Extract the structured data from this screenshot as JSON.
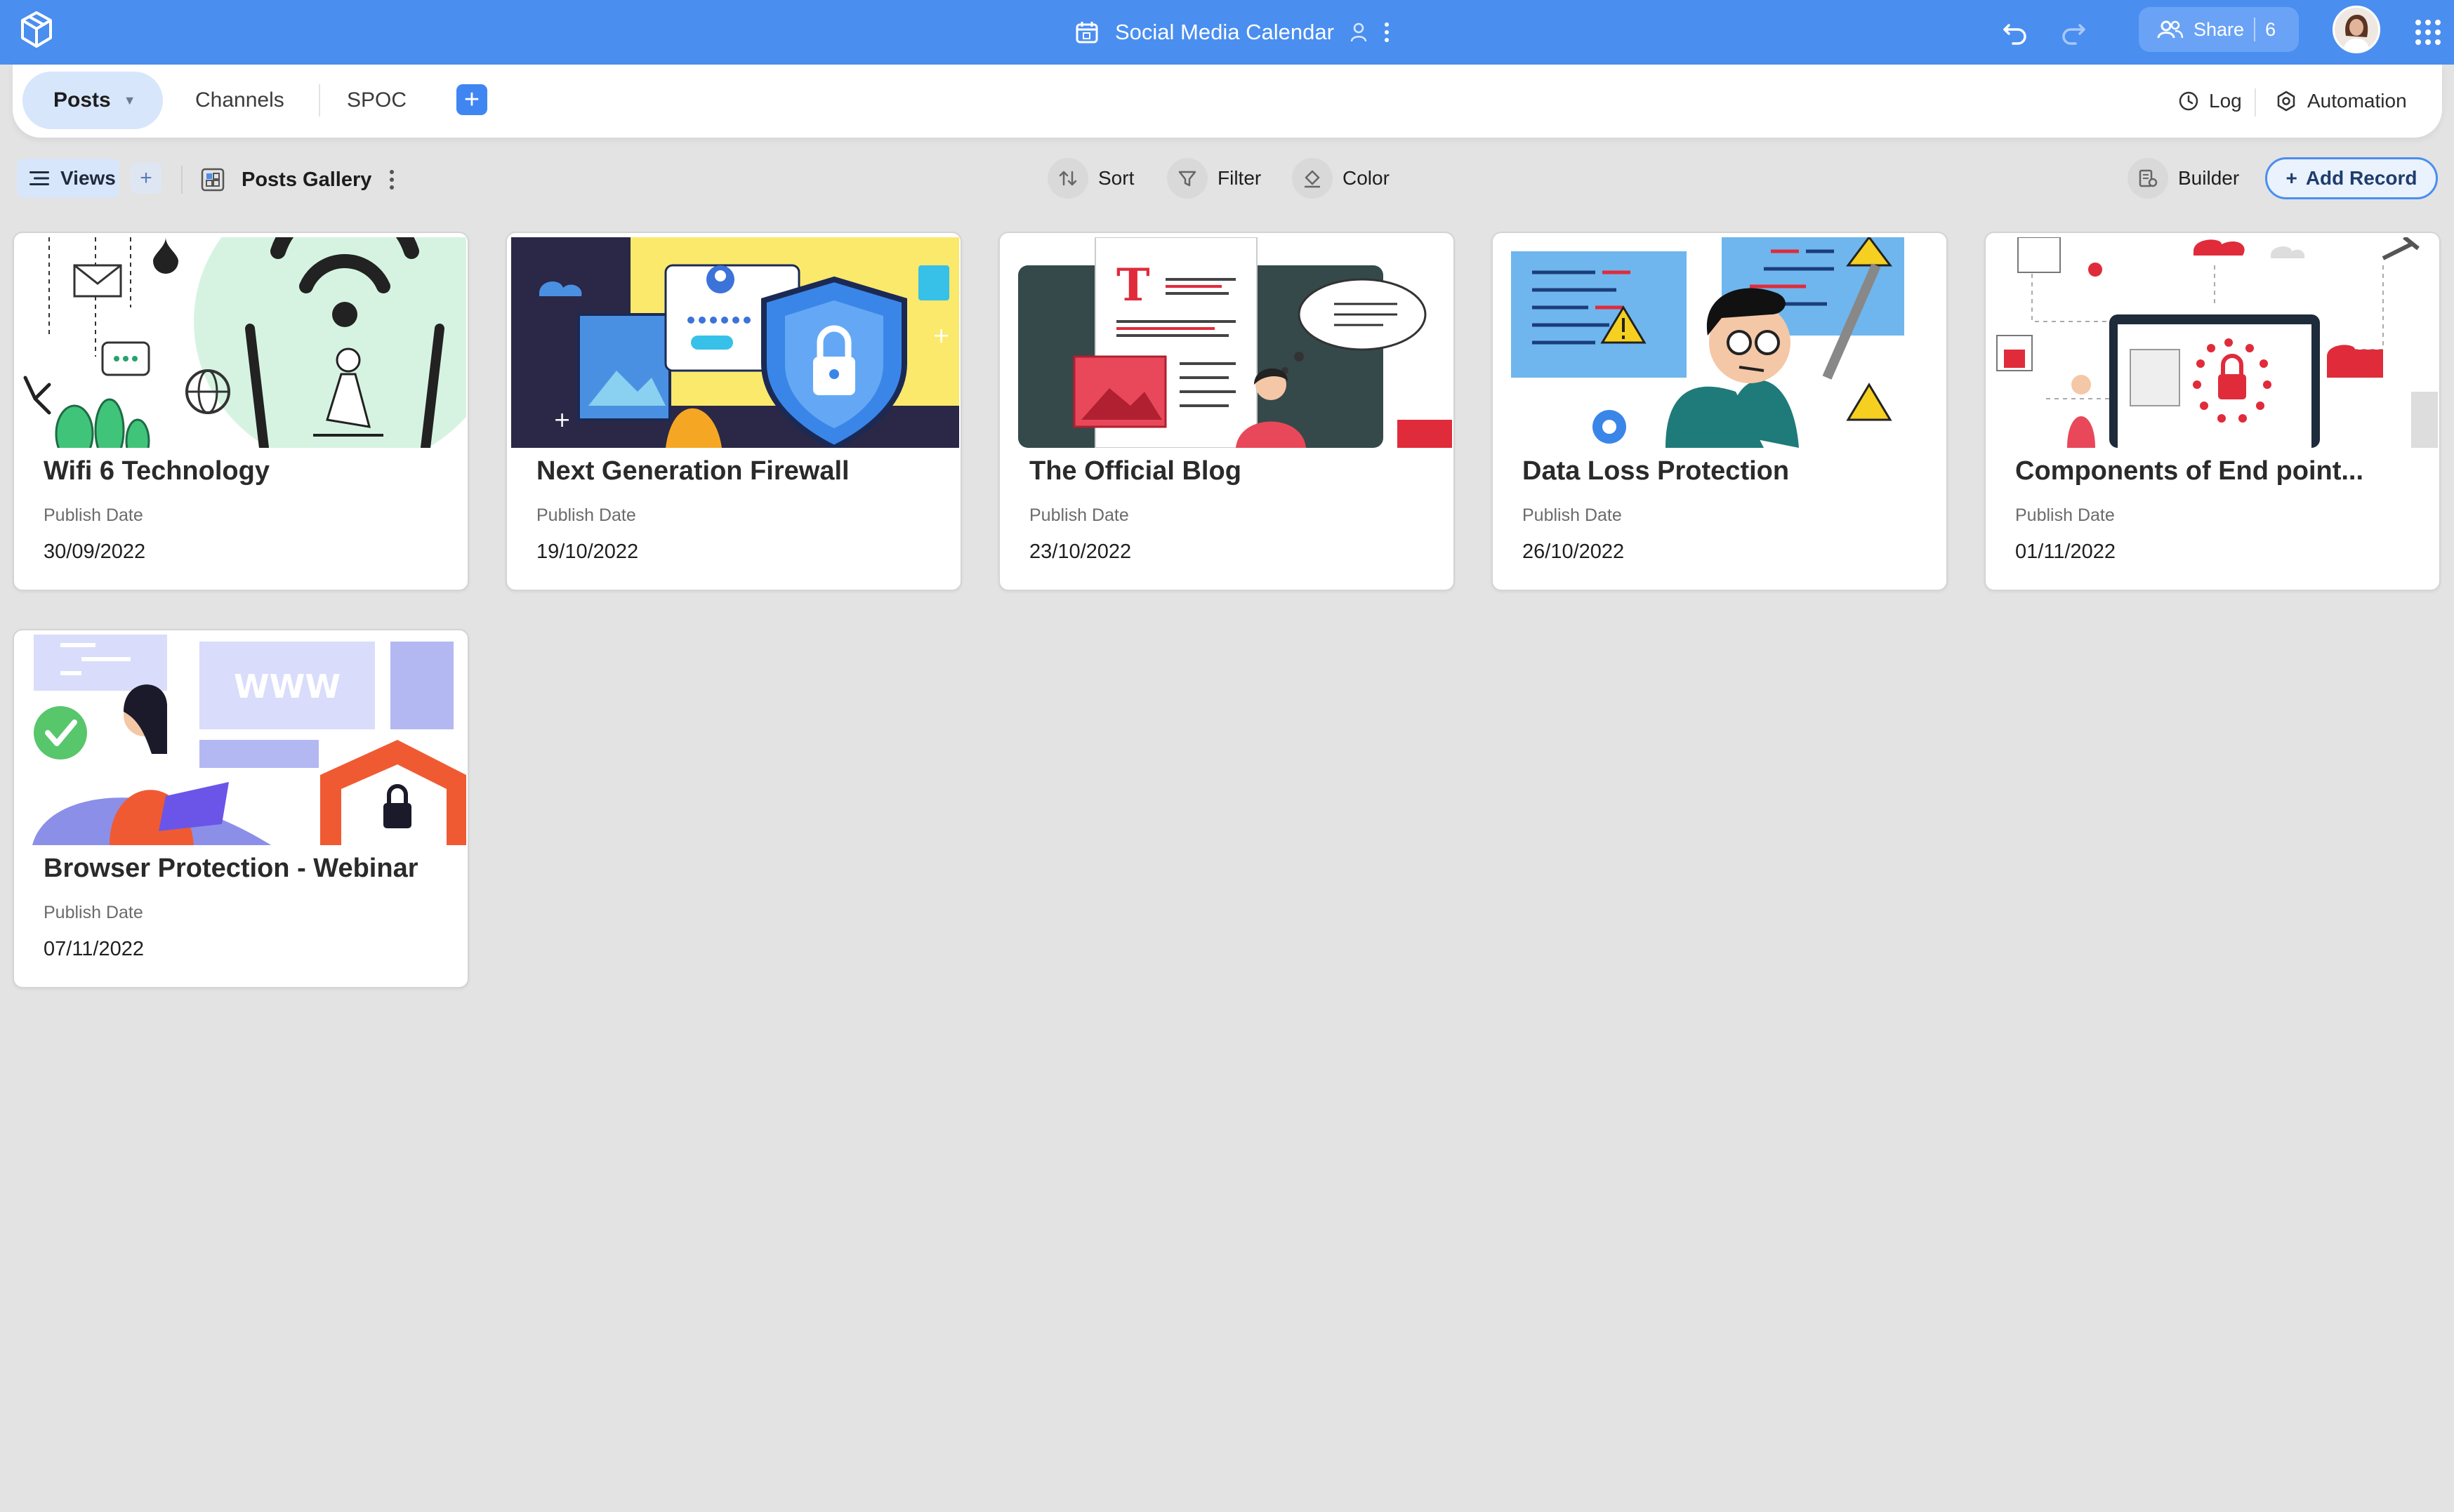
{
  "header": {
    "title": "Social Media Calendar",
    "share_label": "Share",
    "share_count": "6"
  },
  "tabs": [
    {
      "label": "Posts",
      "active": true
    },
    {
      "label": "Channels",
      "active": false
    },
    {
      "label": "SPOC",
      "active": false
    }
  ],
  "tab_actions": {
    "log_label": "Log",
    "automation_label": "Automation"
  },
  "viewbar": {
    "views_label": "Views",
    "view_name": "Posts Gallery",
    "sort_label": "Sort",
    "filter_label": "Filter",
    "color_label": "Color",
    "builder_label": "Builder",
    "add_record_label": "Add Record"
  },
  "cards": [
    {
      "title": "Wifi 6 Technology",
      "field_label": "Publish Date",
      "field_value": "30/09/2022"
    },
    {
      "title": "Next Generation Firewall",
      "field_label": "Publish Date",
      "field_value": "19/10/2022"
    },
    {
      "title": "The Official Blog",
      "field_label": "Publish Date",
      "field_value": "23/10/2022"
    },
    {
      "title": "Data Loss Protection",
      "field_label": "Publish Date",
      "field_value": "26/10/2022"
    },
    {
      "title": "Components of End point...",
      "field_label": "Publish Date",
      "field_value": "01/11/2022"
    },
    {
      "title": "Browser Protection - Webinar",
      "field_label": "Publish Date",
      "field_value": "07/11/2022"
    }
  ],
  "cover_text": {
    "blog_letter": "T",
    "www_label": "WWW"
  },
  "colors": {
    "header_blue": "#4a8ef0",
    "active_tab_bg": "#d8e6fb",
    "page_bg": "#e3e3e3"
  }
}
